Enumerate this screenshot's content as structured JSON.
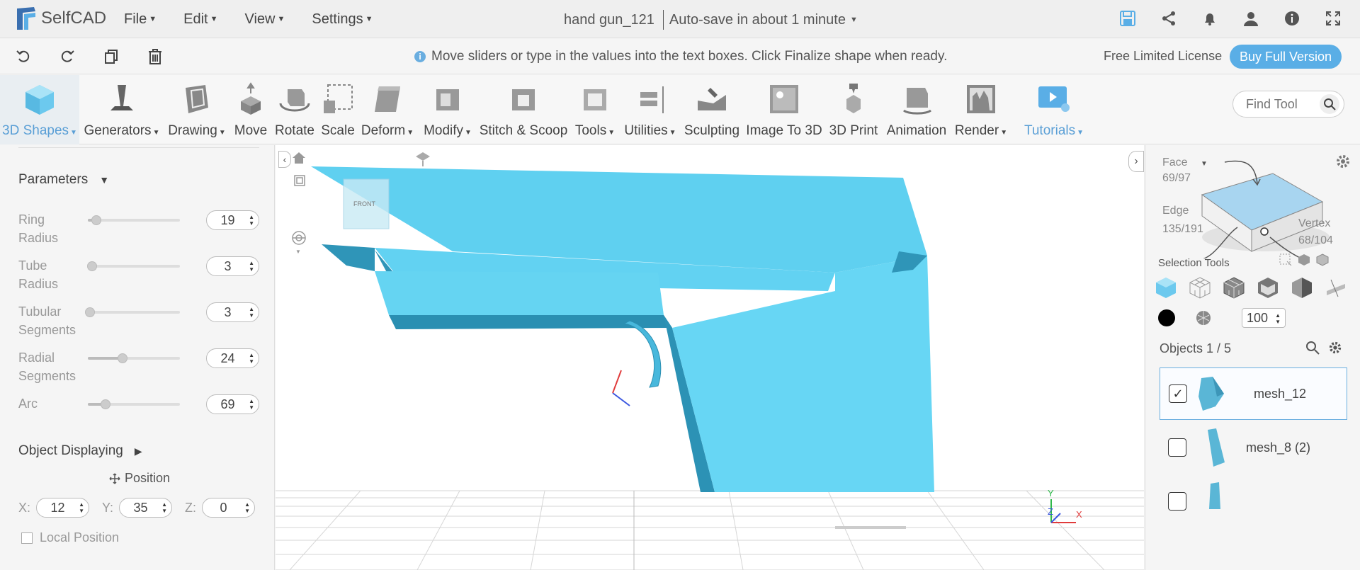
{
  "app": {
    "name": "SelfCAD"
  },
  "menus": [
    "File",
    "Edit",
    "View",
    "Settings"
  ],
  "document": {
    "title": "hand gun_121",
    "autosave": "Auto-save in about 1 minute"
  },
  "hint": "Move sliders or type in the values into the text boxes. Click Finalize shape when ready.",
  "license": {
    "label": "Free Limited License",
    "buy": "Buy Full Version"
  },
  "tools": [
    {
      "label": "3D Shapes",
      "dropdown": true
    },
    {
      "label": "Generators",
      "dropdown": true
    },
    {
      "label": "Drawing",
      "dropdown": true
    },
    {
      "label": "Move",
      "dropdown": false
    },
    {
      "label": "Rotate",
      "dropdown": false
    },
    {
      "label": "Scale",
      "dropdown": false
    },
    {
      "label": "Deform",
      "dropdown": true
    },
    {
      "label": "Modify",
      "dropdown": true
    },
    {
      "label": "Stitch & Scoop",
      "dropdown": false
    },
    {
      "label": "Tools",
      "dropdown": true
    },
    {
      "label": "Utilities",
      "dropdown": true
    },
    {
      "label": "Sculpting",
      "dropdown": false
    },
    {
      "label": "Image To 3D",
      "dropdown": false
    },
    {
      "label": "3D Print",
      "dropdown": false
    },
    {
      "label": "Animation",
      "dropdown": false
    },
    {
      "label": "Render",
      "dropdown": true
    },
    {
      "label": "Tutorials",
      "dropdown": true
    }
  ],
  "find_tool": {
    "placeholder": "Find Tool"
  },
  "parameters": {
    "title": "Parameters",
    "items": [
      {
        "label": "Ring Radius",
        "value": "19",
        "fraction": 0.07
      },
      {
        "label": "Tube Radius",
        "value": "3",
        "fraction": 0.02
      },
      {
        "label": "Tubular Segments",
        "value": "3",
        "fraction": 0.0
      },
      {
        "label": "Radial Segments",
        "value": "24",
        "fraction": 0.35
      },
      {
        "label": "Arc",
        "value": "69",
        "fraction": 0.17
      }
    ]
  },
  "object_displaying": {
    "title": "Object Displaying",
    "position_label": "Position",
    "x_label": "X:",
    "x": "12",
    "y_label": "Y:",
    "y": "35",
    "z_label": "Z:",
    "z": "0",
    "local_position": "Local Position"
  },
  "viewport": {
    "cube_label": "FRONT"
  },
  "selection": {
    "face_label": "Face",
    "face_count": "69/97",
    "edge_label": "Edge",
    "edge_count": "135/191",
    "vertex_label": "Vertex",
    "vertex_count": "68/104",
    "tools_label": "Selection Tools",
    "opacity": "100"
  },
  "objects": {
    "label": "Objects 1 / 5",
    "items": [
      {
        "name": "mesh_12",
        "checked": true
      },
      {
        "name": "mesh_8 (2)",
        "checked": false
      }
    ]
  },
  "colors": {
    "accent": "#5aaee6",
    "model": "#5fd0f0"
  }
}
